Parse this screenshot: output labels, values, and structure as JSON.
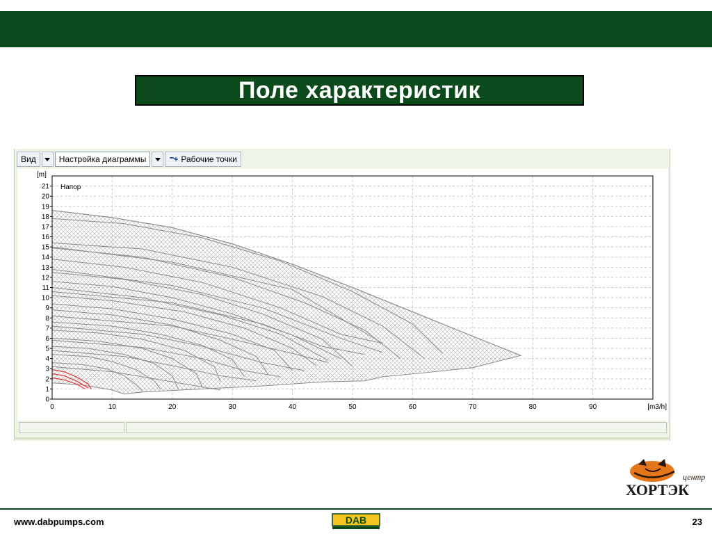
{
  "slide": {
    "title": "Поле характеристик",
    "footer_url": "www.dabpumps.com",
    "page_number": "23",
    "brand_color": "#0b4a1a",
    "logo_text_top": "центр",
    "logo_text_main": "ХОРТЭК",
    "dab_logo_text": "DAB"
  },
  "toolbar": {
    "view_label": "Вид",
    "chart_settings_label": "Настройка диаграммы",
    "work_points_label": "Рабочие точки"
  },
  "chart_data": {
    "type": "line",
    "title": "",
    "series_label": "Напор",
    "ylabel": "[m]",
    "xlabel": "[m3/h]",
    "xlim": [
      0,
      100
    ],
    "ylim": [
      0,
      22
    ],
    "xticks": [
      0,
      10,
      20,
      30,
      40,
      50,
      60,
      70,
      80,
      90
    ],
    "yticks": [
      0,
      1,
      2,
      3,
      4,
      5,
      6,
      7,
      8,
      9,
      10,
      11,
      12,
      13,
      14,
      15,
      16,
      17,
      18,
      19,
      20,
      21
    ],
    "grid": true,
    "curve_color": "#8a8a8a",
    "highlight_color": "#e03030",
    "envelope": {
      "upper": [
        [
          0,
          18.6
        ],
        [
          10,
          17.9
        ],
        [
          20,
          16.9
        ],
        [
          30,
          15.3
        ],
        [
          40,
          13.3
        ],
        [
          50,
          11.0
        ],
        [
          60,
          8.6
        ],
        [
          70,
          6.2
        ],
        [
          78,
          4.3
        ]
      ],
      "lower": [
        [
          78,
          4.3
        ],
        [
          70,
          3.1
        ],
        [
          62,
          2.6
        ],
        [
          55,
          2.2
        ],
        [
          52,
          1.8
        ],
        [
          45,
          1.7
        ],
        [
          35,
          1.3
        ],
        [
          25,
          1.0
        ],
        [
          15,
          0.7
        ],
        [
          12,
          0.5
        ],
        [
          10,
          0.9
        ],
        [
          5,
          1.4
        ],
        [
          0,
          1.6
        ]
      ]
    },
    "series": [
      {
        "values": [
          [
            0,
            18.6
          ],
          [
            10,
            17.9
          ],
          [
            20,
            16.9
          ],
          [
            30,
            15.3
          ],
          [
            40,
            13.3
          ],
          [
            50,
            11.0
          ],
          [
            60,
            8.6
          ],
          [
            70,
            6.2
          ],
          [
            78,
            4.3
          ]
        ]
      },
      {
        "values": [
          [
            0,
            17.8
          ],
          [
            12,
            17.3
          ],
          [
            25,
            15.9
          ],
          [
            38,
            13.6
          ],
          [
            50,
            10.6
          ],
          [
            60,
            7.4
          ],
          [
            65,
            4.5
          ]
        ]
      },
      {
        "values": [
          [
            0,
            15.4
          ],
          [
            15,
            14.8
          ],
          [
            30,
            13.0
          ],
          [
            45,
            10.1
          ],
          [
            55,
            7.2
          ],
          [
            62,
            4.0
          ]
        ]
      },
      {
        "values": [
          [
            0,
            14.9
          ],
          [
            15,
            14.0
          ],
          [
            30,
            12.0
          ],
          [
            42,
            9.5
          ],
          [
            52,
            6.8
          ],
          [
            58,
            4.0
          ]
        ]
      },
      {
        "values": [
          [
            0,
            13.8
          ],
          [
            12,
            13.0
          ],
          [
            25,
            11.5
          ],
          [
            38,
            9.0
          ],
          [
            48,
            6.4
          ],
          [
            55,
            5.5
          ]
        ]
      },
      {
        "values": [
          [
            0,
            12.5
          ],
          [
            12,
            11.8
          ],
          [
            25,
            10.3
          ],
          [
            35,
            8.4
          ],
          [
            45,
            5.9
          ],
          [
            50,
            3.2
          ]
        ]
      },
      {
        "values": [
          [
            0,
            11.6
          ],
          [
            10,
            11.1
          ],
          [
            20,
            10.0
          ],
          [
            30,
            8.4
          ],
          [
            40,
            6.3
          ],
          [
            48,
            4.0
          ]
        ]
      },
      {
        "values": [
          [
            0,
            11.0
          ],
          [
            15,
            10.0
          ],
          [
            28,
            8.3
          ],
          [
            38,
            6.4
          ],
          [
            46,
            3.8
          ]
        ]
      },
      {
        "values": [
          [
            0,
            10.2
          ],
          [
            10,
            9.7
          ],
          [
            22,
            8.6
          ],
          [
            32,
            7.0
          ],
          [
            40,
            5.0
          ],
          [
            44,
            3.3
          ]
        ]
      },
      {
        "values": [
          [
            0,
            9.4
          ],
          [
            10,
            8.9
          ],
          [
            20,
            7.9
          ],
          [
            30,
            6.4
          ],
          [
            37,
            4.8
          ],
          [
            40,
            2.8
          ]
        ]
      },
      {
        "values": [
          [
            0,
            8.8
          ],
          [
            10,
            8.3
          ],
          [
            20,
            7.3
          ],
          [
            28,
            5.8
          ],
          [
            34,
            4.2
          ],
          [
            36,
            2.4
          ]
        ]
      },
      {
        "values": [
          [
            0,
            7.6
          ],
          [
            10,
            7.2
          ],
          [
            18,
            6.4
          ],
          [
            25,
            5.3
          ],
          [
            30,
            3.9
          ],
          [
            32,
            2.2
          ]
        ]
      },
      {
        "values": [
          [
            0,
            6.8
          ],
          [
            8,
            6.5
          ],
          [
            15,
            5.9
          ],
          [
            22,
            4.8
          ],
          [
            27,
            3.2
          ],
          [
            28,
            1.7
          ]
        ]
      },
      {
        "values": [
          [
            0,
            6.0
          ],
          [
            8,
            5.7
          ],
          [
            15,
            5.0
          ],
          [
            20,
            4.0
          ],
          [
            24,
            2.5
          ],
          [
            25,
            1.2
          ]
        ]
      },
      {
        "values": [
          [
            0,
            5.2
          ],
          [
            6,
            5.0
          ],
          [
            12,
            4.4
          ],
          [
            17,
            3.5
          ],
          [
            20,
            2.3
          ],
          [
            21,
            1.0
          ]
        ]
      },
      {
        "values": [
          [
            0,
            4.4
          ],
          [
            6,
            4.2
          ],
          [
            10,
            3.7
          ],
          [
            14,
            2.9
          ],
          [
            17,
            1.8
          ],
          [
            18,
            1.0
          ]
        ]
      },
      {
        "values": [
          [
            0,
            3.6
          ],
          [
            5,
            3.4
          ],
          [
            9,
            3.0
          ],
          [
            12,
            2.3
          ],
          [
            14,
            1.4
          ],
          [
            15,
            0.8
          ]
        ]
      },
      {
        "values": [
          [
            0,
            15.0
          ],
          [
            20,
            13.5
          ],
          [
            40,
            10.8
          ],
          [
            55,
            5.5
          ]
        ]
      },
      {
        "values": [
          [
            0,
            12.8
          ],
          [
            20,
            11.2
          ],
          [
            35,
            9.0
          ],
          [
            48,
            6.0
          ],
          [
            55,
            4.6
          ]
        ]
      },
      {
        "values": [
          [
            0,
            10.6
          ],
          [
            20,
            9.5
          ],
          [
            35,
            7.4
          ],
          [
            45,
            5.2
          ],
          [
            52,
            4.4
          ]
        ]
      },
      {
        "values": [
          [
            0,
            8.2
          ],
          [
            20,
            7.2
          ],
          [
            30,
            5.9
          ],
          [
            40,
            4.5
          ],
          [
            46,
            3.6
          ]
        ]
      },
      {
        "values": [
          [
            0,
            7.2
          ],
          [
            15,
            6.4
          ],
          [
            25,
            5.2
          ],
          [
            35,
            3.6
          ],
          [
            42,
            2.8
          ]
        ]
      },
      {
        "values": [
          [
            0,
            5.8
          ],
          [
            15,
            5.1
          ],
          [
            25,
            4.0
          ],
          [
            32,
            2.8
          ],
          [
            38,
            2.2
          ]
        ]
      },
      {
        "values": [
          [
            0,
            4.8
          ],
          [
            12,
            4.2
          ],
          [
            20,
            3.3
          ],
          [
            28,
            2.3
          ],
          [
            34,
            1.8
          ]
        ]
      },
      {
        "values": [
          [
            0,
            3.2
          ],
          [
            10,
            2.7
          ],
          [
            18,
            1.9
          ],
          [
            25,
            1.2
          ],
          [
            28,
            0.9
          ]
        ]
      }
    ],
    "highlighted_series": [
      {
        "values": [
          [
            0,
            2.9
          ],
          [
            2,
            2.7
          ],
          [
            4,
            2.2
          ],
          [
            6,
            1.5
          ],
          [
            6.5,
            1.0
          ]
        ]
      },
      {
        "values": [
          [
            0,
            2.5
          ],
          [
            2,
            2.3
          ],
          [
            4,
            1.8
          ],
          [
            6,
            1.1
          ]
        ]
      },
      {
        "values": [
          [
            0,
            2.1
          ],
          [
            2,
            1.9
          ],
          [
            4,
            1.5
          ],
          [
            5.5,
            1.0
          ]
        ]
      }
    ]
  }
}
